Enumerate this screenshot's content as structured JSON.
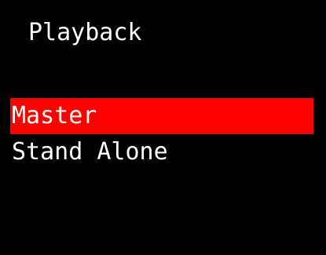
{
  "screen": {
    "title": "Playback",
    "background_color": "#000000",
    "text_color": "#ffffff",
    "highlight_color": "#ff0000"
  },
  "menu": {
    "selected_index": 0,
    "items": [
      {
        "label": "Master",
        "selected": true
      },
      {
        "label": "Stand Alone",
        "selected": false
      }
    ]
  }
}
